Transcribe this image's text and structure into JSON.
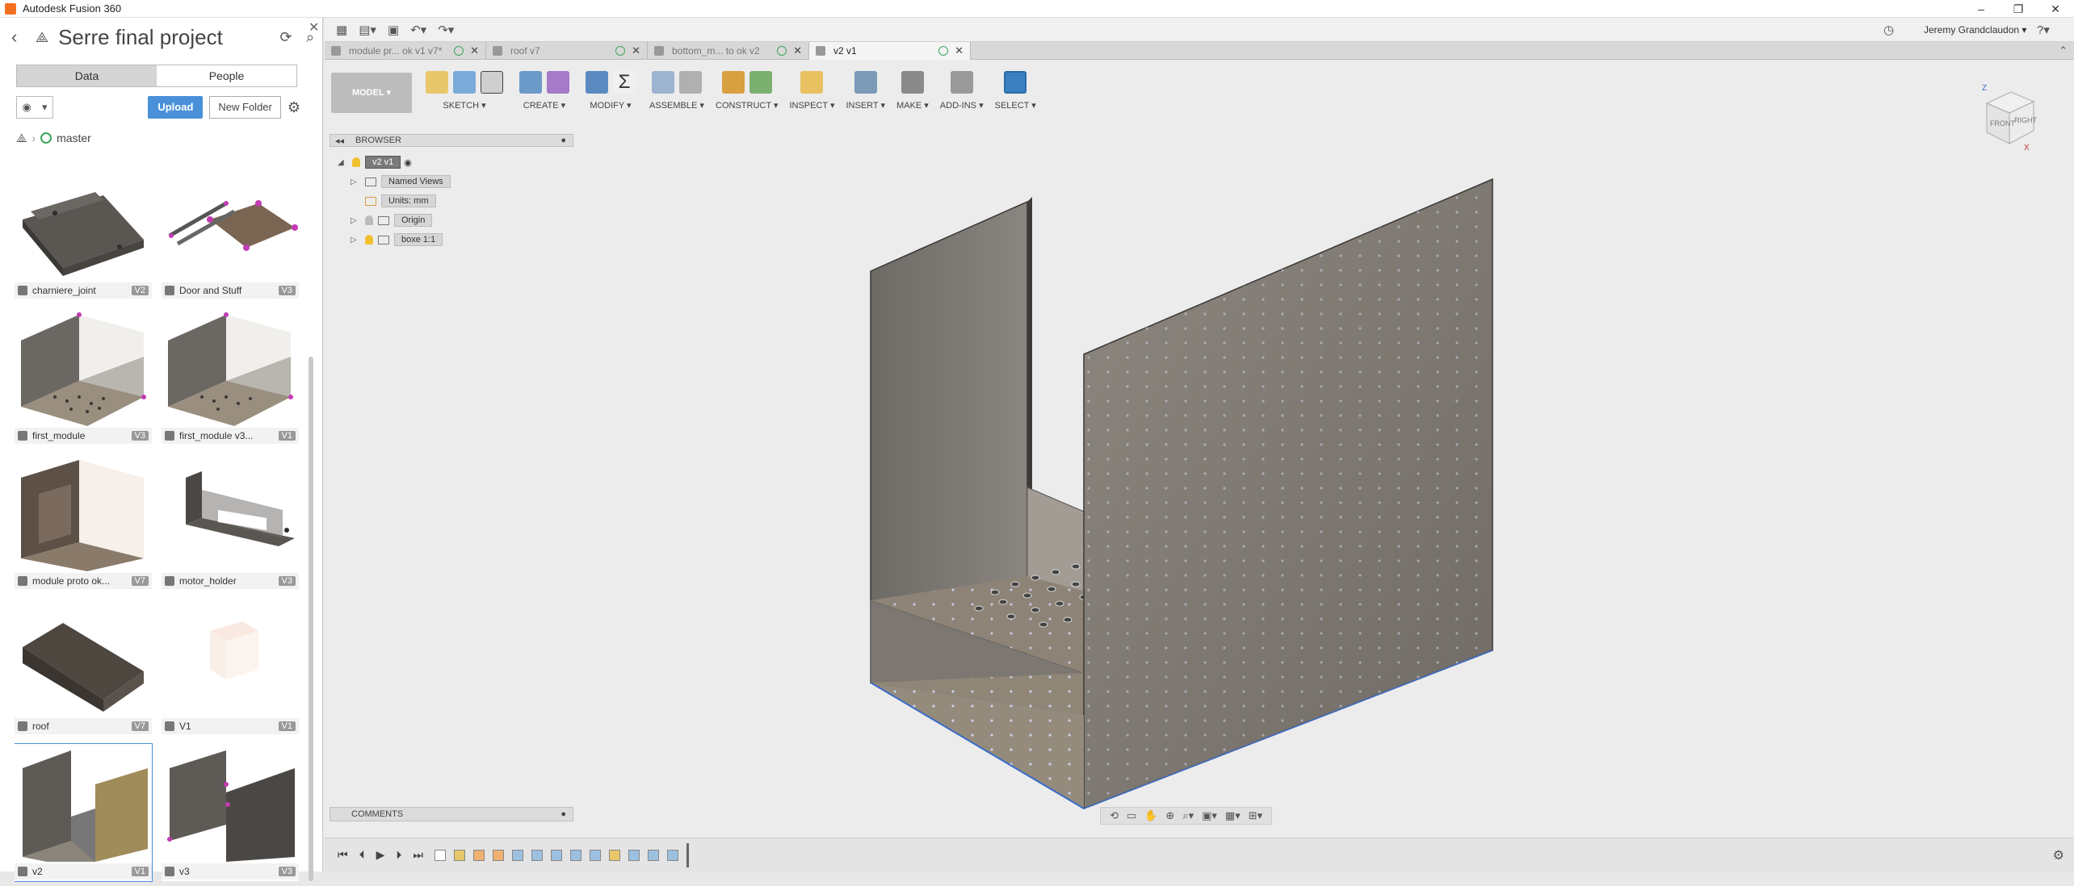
{
  "app": {
    "title": "Autodesk Fusion 360"
  },
  "window_controls": {
    "minimize": "–",
    "restore": "❐",
    "close": "✕"
  },
  "data_panel": {
    "project_title": "Serre final project",
    "tabs": [
      {
        "label": "Data"
      },
      {
        "label": "People"
      }
    ],
    "upload_label": "Upload",
    "new_folder_label": "New Folder",
    "breadcrumb": {
      "branch": "master"
    },
    "items": [
      {
        "name": "charniere_joint",
        "version": "V2"
      },
      {
        "name": "Door and Stuff",
        "version": "V3"
      },
      {
        "name": "first_module",
        "version": "V3"
      },
      {
        "name": "first_module v3...",
        "version": "V1"
      },
      {
        "name": "module proto ok...",
        "version": "V7"
      },
      {
        "name": "motor_holder",
        "version": "V3"
      },
      {
        "name": "roof",
        "version": "V7"
      },
      {
        "name": "V1",
        "version": "V1"
      },
      {
        "name": "v2",
        "version": "V1"
      },
      {
        "name": "v3",
        "version": "V3"
      }
    ]
  },
  "toolbar": {
    "user_name": "Jeremy Grandclaudon ▾"
  },
  "doc_tabs": [
    {
      "label": "module pr... ok v1 v7*"
    },
    {
      "label": "roof v7"
    },
    {
      "label": "bottom_m... to ok v2"
    },
    {
      "label": "v2 v1"
    }
  ],
  "ribbon": {
    "workspace": "MODEL ▾",
    "groups": [
      {
        "label": "SKETCH ▾"
      },
      {
        "label": "CREATE ▾"
      },
      {
        "label": "MODIFY ▾"
      },
      {
        "label": "ASSEMBLE ▾"
      },
      {
        "label": "CONSTRUCT ▾"
      },
      {
        "label": "INSPECT ▾"
      },
      {
        "label": "INSERT ▾"
      },
      {
        "label": "MAKE ▾"
      },
      {
        "label": "ADD-INS ▾"
      },
      {
        "label": "SELECT ▾"
      }
    ]
  },
  "browser": {
    "title": "BROWSER",
    "root": "v2 v1",
    "nodes": [
      {
        "label": "Named Views"
      },
      {
        "label": "Units: mm"
      },
      {
        "label": "Origin"
      },
      {
        "label": "boxe 1:1"
      }
    ]
  },
  "viewcube": {
    "top": "Z",
    "front": "FRONT",
    "right": "RIGHT",
    "axis_x": "X"
  },
  "comments": {
    "title": "COMMENTS"
  },
  "colors": {
    "accent": "#4a90d9",
    "select": "#3a7fc0",
    "model_panel": "#8a8478"
  }
}
